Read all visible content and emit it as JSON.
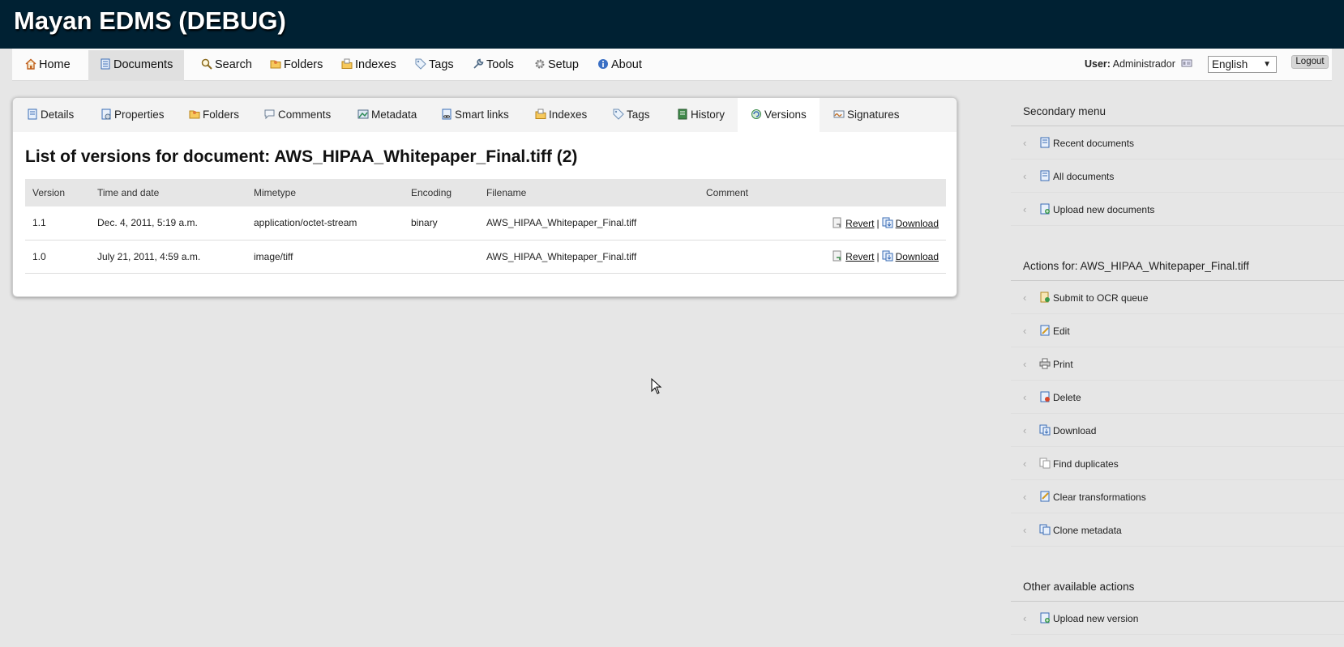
{
  "app": {
    "title": "Mayan EDMS (DEBUG)"
  },
  "mainnav": {
    "items": [
      {
        "label": "Home",
        "icon": "home-icon"
      },
      {
        "label": "Documents",
        "icon": "document-icon"
      },
      {
        "label": "Search",
        "icon": "search-icon"
      },
      {
        "label": "Folders",
        "icon": "folder-icon"
      },
      {
        "label": "Indexes",
        "icon": "indexes-icon"
      },
      {
        "label": "Tags",
        "icon": "tag-icon"
      },
      {
        "label": "Tools",
        "icon": "wrench-icon"
      },
      {
        "label": "Setup",
        "icon": "gear-icon"
      },
      {
        "label": "About",
        "icon": "info-icon"
      }
    ],
    "active": "Documents",
    "user_label": "User:",
    "user_name": "Administrador",
    "language": "English",
    "logout_label": "Logout"
  },
  "tabs": [
    {
      "label": "Details"
    },
    {
      "label": "Properties"
    },
    {
      "label": "Folders"
    },
    {
      "label": "Comments"
    },
    {
      "label": "Metadata"
    },
    {
      "label": "Smart links"
    },
    {
      "label": "Indexes"
    },
    {
      "label": "Tags"
    },
    {
      "label": "History"
    },
    {
      "label": "Versions"
    },
    {
      "label": "Signatures"
    }
  ],
  "active_tab": "Versions",
  "main": {
    "title": "List of versions for document: AWS_HIPAA_Whitepaper_Final.tiff (2)",
    "columns": [
      "Version",
      "Time and date",
      "Mimetype",
      "Encoding",
      "Filename",
      "Comment"
    ],
    "rows": [
      {
        "version": "1.1",
        "datetime": "Dec. 4, 2011, 5:19 a.m.",
        "mimetype": "application/octet-stream",
        "encoding": "binary",
        "filename": "AWS_HIPAA_Whitepaper_Final.tiff",
        "comment": "",
        "revert": "Revert",
        "sep": "|",
        "download": "Download"
      },
      {
        "version": "1.0",
        "datetime": "July 21, 2011, 4:59 a.m.",
        "mimetype": "image/tiff",
        "encoding": "",
        "filename": "AWS_HIPAA_Whitepaper_Final.tiff",
        "comment": "",
        "revert": "Revert",
        "sep": "|",
        "download": "Download"
      }
    ]
  },
  "sidebar": {
    "secondary": {
      "title": "Secondary menu",
      "items": [
        {
          "label": "Recent documents"
        },
        {
          "label": "All documents"
        },
        {
          "label": "Upload new documents"
        }
      ]
    },
    "actions": {
      "title": "Actions for: AWS_HIPAA_Whitepaper_Final.tiff",
      "items": [
        {
          "label": "Submit to OCR queue"
        },
        {
          "label": "Edit"
        },
        {
          "label": "Print"
        },
        {
          "label": "Delete"
        },
        {
          "label": "Download"
        },
        {
          "label": "Find duplicates"
        },
        {
          "label": "Clear transformations"
        },
        {
          "label": "Clone metadata"
        }
      ]
    },
    "other": {
      "title": "Other available actions",
      "items": [
        {
          "label": "Upload new version"
        }
      ]
    }
  }
}
